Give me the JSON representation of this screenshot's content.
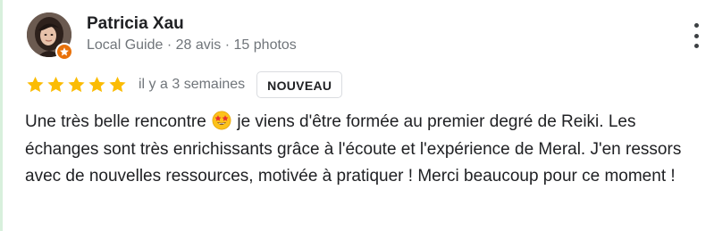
{
  "review": {
    "author": "Patricia Xau",
    "author_meta": "Local Guide · 28 avis · 15 photos",
    "rating": 5,
    "rating_max": 5,
    "time_ago": "il y a 3 semaines",
    "badge_label": "NOUVEAU",
    "text_part1": "Une très belle rencontre ",
    "emoji": "star-struck-emoji",
    "text_part2": " je viens d'être formée au premier degré de Reiki. Les échanges sont très enrichissants grâce à l'écoute et l'expérience de Meral. J'en ressors avec de nouvelles ressources, motivée à pratiquer ! Merci beaucoup pour ce moment !"
  },
  "icons": {
    "avatar": "avatar",
    "local_guide_badge": "local-guide-star-icon",
    "more_options": "more-vert-icon",
    "star": "star-icon"
  },
  "colors": {
    "star": "#fbbc04",
    "badge": "#e8710a",
    "secondary_text": "#70757a",
    "accent_bar": "#d8f0dc"
  }
}
